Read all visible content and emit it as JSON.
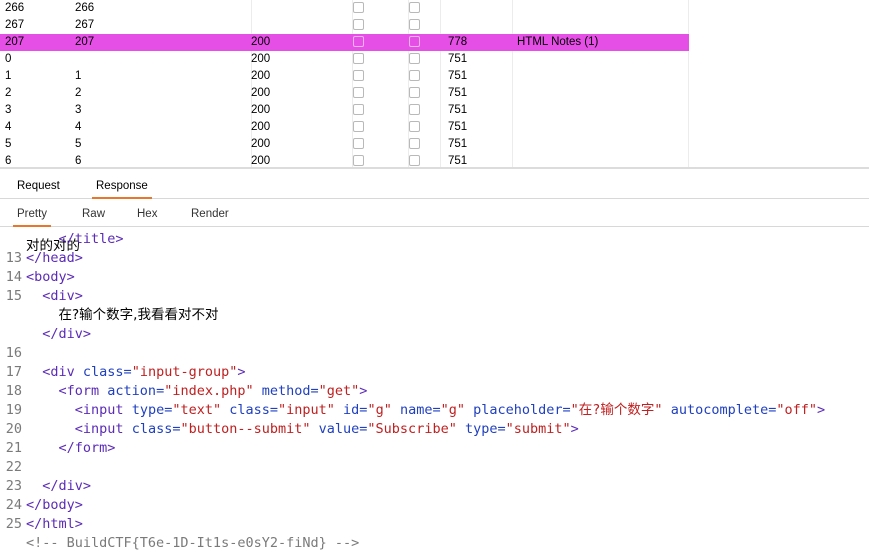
{
  "table": {
    "rows": [
      {
        "request": "266",
        "payload": "266",
        "status": "",
        "length": "",
        "comment": "",
        "selected": false
      },
      {
        "request": "267",
        "payload": "267",
        "status": "",
        "length": "",
        "comment": "",
        "selected": false
      },
      {
        "request": "207",
        "payload": "207",
        "status": "200",
        "length": "778",
        "comment": "HTML Notes (1)",
        "selected": true
      },
      {
        "request": "0",
        "payload": "",
        "status": "200",
        "length": "751",
        "comment": "",
        "selected": false
      },
      {
        "request": "1",
        "payload": "1",
        "status": "200",
        "length": "751",
        "comment": "",
        "selected": false
      },
      {
        "request": "2",
        "payload": "2",
        "status": "200",
        "length": "751",
        "comment": "",
        "selected": false
      },
      {
        "request": "3",
        "payload": "3",
        "status": "200",
        "length": "751",
        "comment": "",
        "selected": false
      },
      {
        "request": "4",
        "payload": "4",
        "status": "200",
        "length": "751",
        "comment": "",
        "selected": false
      },
      {
        "request": "5",
        "payload": "5",
        "status": "200",
        "length": "751",
        "comment": "",
        "selected": false
      },
      {
        "request": "6",
        "payload": "6",
        "status": "200",
        "length": "751",
        "comment": "",
        "selected": false
      }
    ]
  },
  "tabs": {
    "request": "Request",
    "response": "Response",
    "active": "Response"
  },
  "view_tabs": {
    "pretty": "Pretty",
    "raw": "Raw",
    "hex": "Hex",
    "render": "Render",
    "active": "Pretty"
  },
  "editor": {
    "clipped_text": "对的对的",
    "lines": [
      {
        "n": "",
        "indent": "    ",
        "tokens": [
          [
            "t",
            "</title>"
          ]
        ]
      },
      {
        "n": "13",
        "indent": "",
        "tokens": [
          [
            "t",
            "</head>"
          ]
        ]
      },
      {
        "n": "14",
        "indent": "",
        "tokens": [
          [
            "t",
            "<body>"
          ]
        ]
      },
      {
        "n": "15",
        "indent": "  ",
        "tokens": [
          [
            "t",
            "<div>"
          ]
        ]
      },
      {
        "n": "",
        "indent": "    ",
        "tokens": [
          [
            "x",
            "在?输个数字,我看看对不对"
          ]
        ]
      },
      {
        "n": "",
        "indent": "  ",
        "tokens": [
          [
            "t",
            "</div>"
          ]
        ]
      },
      {
        "n": "16",
        "indent": "",
        "tokens": []
      },
      {
        "n": "17",
        "indent": "  ",
        "tokens": [
          [
            "t",
            "<div "
          ],
          [
            "a",
            "class="
          ],
          [
            "v",
            "\"input-group\""
          ],
          [
            "t",
            ">"
          ]
        ]
      },
      {
        "n": "18",
        "indent": "    ",
        "tokens": [
          [
            "t",
            "<form "
          ],
          [
            "a",
            "action="
          ],
          [
            "v",
            "\"index.php\""
          ],
          [
            "a",
            " method="
          ],
          [
            "v",
            "\"get\""
          ],
          [
            "t",
            ">"
          ]
        ]
      },
      {
        "n": "19",
        "indent": "      ",
        "tokens": [
          [
            "t",
            "<input "
          ],
          [
            "a",
            "type="
          ],
          [
            "v",
            "\"text\""
          ],
          [
            "a",
            " class="
          ],
          [
            "v",
            "\"input\""
          ],
          [
            "a",
            " id="
          ],
          [
            "v",
            "\"g\""
          ],
          [
            "a",
            " name="
          ],
          [
            "v",
            "\"g\""
          ],
          [
            "a",
            " placeholder="
          ],
          [
            "v",
            "\"在?输个数字\""
          ],
          [
            "a",
            " autocomplete="
          ],
          [
            "v",
            "\"off\""
          ],
          [
            "t",
            ">"
          ]
        ]
      },
      {
        "n": "20",
        "indent": "      ",
        "tokens": [
          [
            "t",
            "<input "
          ],
          [
            "a",
            "class="
          ],
          [
            "v",
            "\"button--submit\""
          ],
          [
            "a",
            " value="
          ],
          [
            "v",
            "\"Subscribe\""
          ],
          [
            "a",
            " type="
          ],
          [
            "v",
            "\"submit\""
          ],
          [
            "t",
            ">"
          ]
        ]
      },
      {
        "n": "21",
        "indent": "    ",
        "tokens": [
          [
            "t",
            "</form>"
          ]
        ]
      },
      {
        "n": "22",
        "indent": "",
        "tokens": []
      },
      {
        "n": "23",
        "indent": "  ",
        "tokens": [
          [
            "t",
            "</div>"
          ]
        ]
      },
      {
        "n": "24",
        "indent": "",
        "tokens": [
          [
            "t",
            "</body>"
          ]
        ]
      },
      {
        "n": "25",
        "indent": "",
        "tokens": [
          [
            "t",
            "</html>"
          ]
        ]
      },
      {
        "n": "",
        "indent": "",
        "tokens": [
          [
            "cm",
            "<!-- BuildCTF{T6e-1D-It1s-e0sY2-fiNd} -->"
          ]
        ]
      }
    ]
  },
  "colors": {
    "selected_row": "#e54fe6",
    "active_tab_underline": "#e8762c"
  }
}
